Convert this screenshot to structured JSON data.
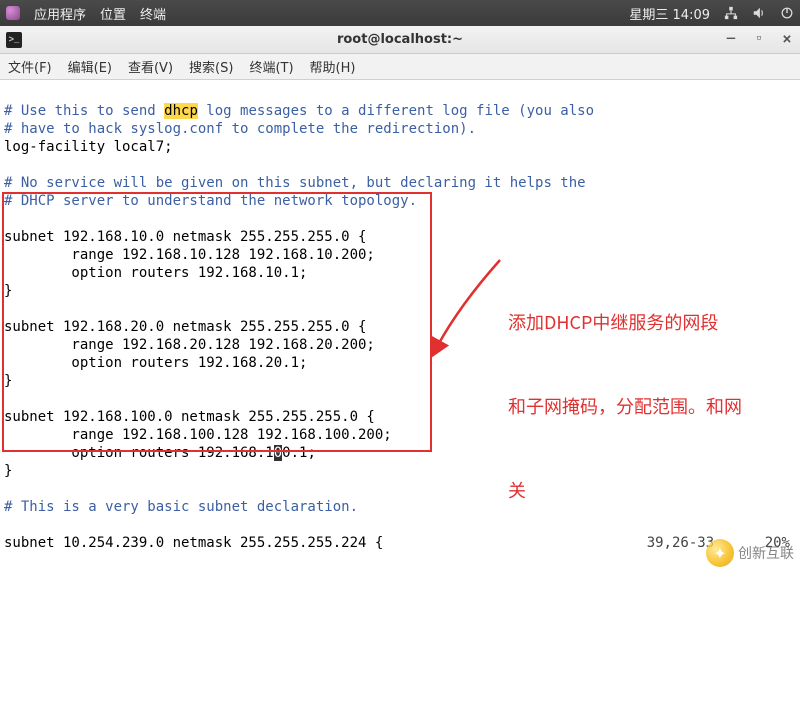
{
  "panel": {
    "applications": "应用程序",
    "places": "位置",
    "terminal": "终端",
    "clock": "星期三 14:09"
  },
  "window": {
    "title": "root@localhost:~"
  },
  "menu": {
    "file": "文件(F)",
    "edit": "编辑(E)",
    "view": "查看(V)",
    "search": "搜索(S)",
    "terminal": "终端(T)",
    "help": "帮助(H)"
  },
  "code": {
    "c1a": "# Use this to send ",
    "c1b": "dhcp",
    "c1c": " log messages to a different log file (you also",
    "c2": "# have to hack syslog.conf to complete the redirection).",
    "l3": "log-facility local7;",
    "c4": "# No service will be given on this subnet, but declaring it helps the",
    "c5": "# DHCP server to understand the network topology.",
    "s1a": "subnet 192.168.10.0 netmask 255.255.255.0 {",
    "s1b": "        range 192.168.10.128 192.168.10.200;",
    "s1c": "        option routers 192.168.10.1;",
    "s1d": "}",
    "s2a": "subnet 192.168.20.0 netmask 255.255.255.0 {",
    "s2b": "        range 192.168.20.128 192.168.20.200;",
    "s2c": "        option routers 192.168.20.1;",
    "s2d": "}",
    "s3a": "subnet 192.168.100.0 netmask 255.255.255.0 {",
    "s3b": "        range 192.168.100.128 192.168.100.200;",
    "s3c_pre": "        option routers 192.168.1",
    "s3c_cur": "0",
    "s3c_post": "0.1;",
    "s3d": "}",
    "c6": "# This is a very basic subnet declaration.",
    "s4": "subnet 10.254.239.0 netmask 255.255.255.224 {"
  },
  "annotation": {
    "line1": "添加DHCP中继服务的网段",
    "line2": "和子网掩码，分配范围。和网",
    "line3": "关"
  },
  "status": {
    "pos": "39,26-33",
    "pct": "20%"
  },
  "watermark": {
    "text": "创新互联"
  }
}
